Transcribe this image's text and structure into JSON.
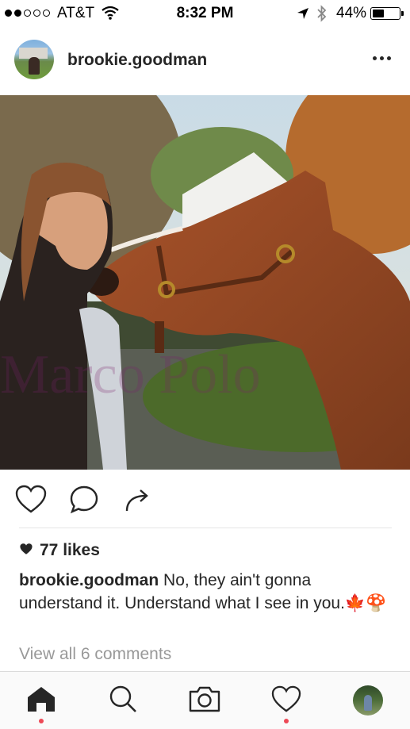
{
  "status_bar": {
    "signal_bars_filled": 2,
    "signal_bars_total": 5,
    "carrier": "AT&T",
    "time": "8:32 PM",
    "battery_percent": "44%",
    "battery_level": 0.44,
    "icons": [
      "wifi-icon",
      "location-arrow-icon",
      "bluetooth-icon",
      "battery-icon"
    ]
  },
  "post": {
    "username": "brookie.goodman",
    "more_icon": "more-options-icon",
    "photo_watermark": "Marco Polo",
    "actions": [
      "like-heart-icon",
      "comment-bubble-icon",
      "share-arrow-icon"
    ],
    "likes_text": "77 likes",
    "caption_user": "brookie.goodman",
    "caption_text": " No, they ain't gonna understand it. Understand what I see in you.🍁🍄",
    "view_comments": "View all 6 comments"
  },
  "tab_bar": {
    "tabs": [
      "home-icon",
      "search-icon",
      "camera-icon",
      "activity-heart-icon",
      "profile-avatar"
    ],
    "active_tab": "home",
    "notification_dot_color": "#ed4956"
  },
  "colors": {
    "text": "#262626",
    "muted": "#999999",
    "divider": "#e5e5e5"
  }
}
